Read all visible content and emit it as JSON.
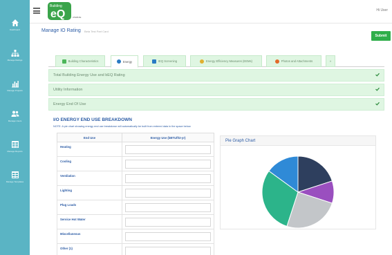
{
  "sidebar": {
    "items": [
      {
        "label": "Dashboard",
        "icon": "home-icon"
      },
      {
        "label": "Manage Ratings",
        "icon": "org-chart-icon"
      },
      {
        "label": "Manage Projects",
        "icon": "bar-chart-icon"
      },
      {
        "label": "Manage Users",
        "icon": "users-icon"
      },
      {
        "label": "Manage Reports",
        "icon": "table-icon"
      },
      {
        "label": "Manage Templates",
        "icon": "table-icon"
      }
    ]
  },
  "header": {
    "logo_top": "Building",
    "logo_main": "eQ",
    "logo_sub": "ASHRAE",
    "user": "Hi User"
  },
  "page": {
    "title": "Manage IO Rating",
    "subtitle": "Beta Test Part Card",
    "submit_label": "Submit"
  },
  "tabs": [
    {
      "label": "Building Characteristics",
      "icon_color": "#4cb65a",
      "active": false
    },
    {
      "label": "Energy",
      "icon_color": "#2a7bc4",
      "active": true
    },
    {
      "label": "IEQ Screening",
      "icon_color": "#2a7bc4",
      "active": false
    },
    {
      "label": "Energy Efficiency Measures (EEMs)",
      "icon_color": "#e0b030",
      "active": false
    },
    {
      "label": "Photos and Attachments",
      "icon_color": "#e36a2a",
      "active": false
    },
    {
      "label": "»",
      "icon_color": "",
      "active": false
    }
  ],
  "accordions": [
    {
      "label": "Total Building Energy Use and bEQ Rating"
    },
    {
      "label": "Utility Information"
    },
    {
      "label": "Energy End Of Use"
    }
  ],
  "breakdown": {
    "title": "I/O ENERGY END USE BREAKDOWN",
    "note": "NOTE: A pie chart showing energy end use breakdown will automatically be built from entered data in the space below.",
    "col_end_use": "End Use",
    "col_energy": "Energy Use (kBTU/ft2-yr)",
    "rows": [
      {
        "label": "Heating",
        "value": ""
      },
      {
        "label": "Cooling",
        "value": ""
      },
      {
        "label": "Ventilation",
        "value": ""
      },
      {
        "label": "Lighting",
        "value": ""
      },
      {
        "label": "Plug Loads",
        "value": ""
      },
      {
        "label": "Service Hot Water",
        "value": ""
      },
      {
        "label": "Miscellaneous",
        "value": ""
      },
      {
        "label": "Other (1)",
        "value": ""
      }
    ]
  },
  "pie_card": {
    "title": "Pie Graph Chart"
  },
  "chart_data": {
    "type": "pie",
    "title": "Pie Graph Chart",
    "values": [
      20,
      10,
      25,
      30,
      15
    ],
    "colors": [
      "#2e3f5e",
      "#9a4fbf",
      "#c3c6c9",
      "#2cb48a",
      "#2f8ad7"
    ]
  },
  "colors": {
    "sidebar": "#5ab4c4",
    "accent_green": "#2fae4a",
    "accordion_bg": "#dff6e2",
    "heading_blue": "#2a5aa4"
  }
}
